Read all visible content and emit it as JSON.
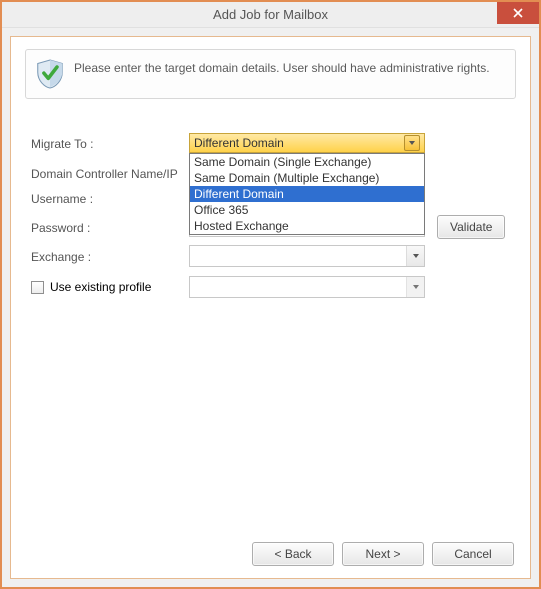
{
  "title": "Add Job for Mailbox",
  "info": "Please enter the target domain details. User should have administrative rights.",
  "labels": {
    "migrate_to": "Migrate To :",
    "domain_controller": "Domain Controller Name/IP",
    "username": "Username :",
    "password": "Password :",
    "exchange": "Exchange :",
    "use_existing": "Use existing profile"
  },
  "combo": {
    "selected": "Different Domain",
    "options": [
      "Same Domain (Single Exchange)",
      "Same Domain (Multiple Exchange)",
      "Different Domain",
      "Office 365",
      "Hosted Exchange"
    ],
    "selected_index": 2
  },
  "buttons": {
    "validate": "Validate",
    "back": "< Back",
    "next": "Next >",
    "cancel": "Cancel"
  }
}
